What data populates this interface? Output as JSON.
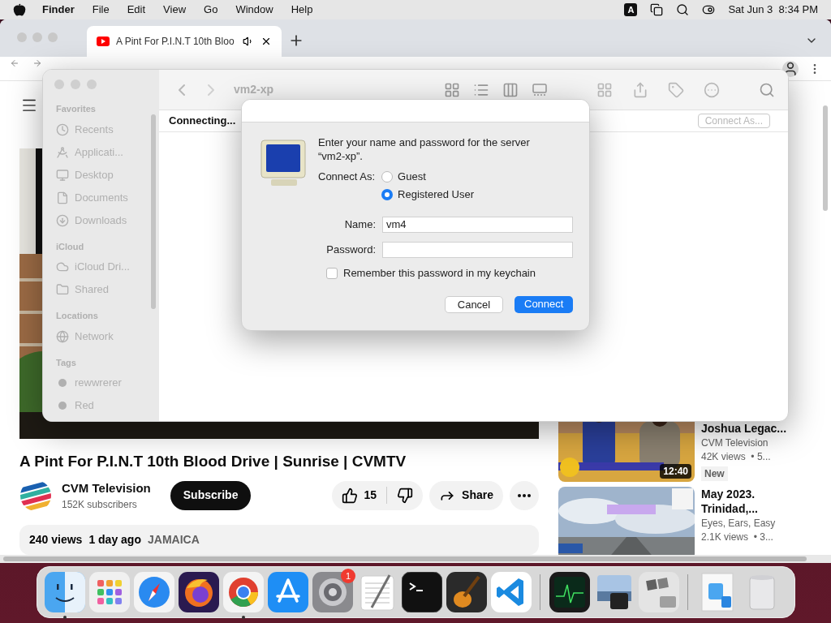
{
  "menu_bar": {
    "app": "Finder",
    "menus": [
      "File",
      "Edit",
      "View",
      "Go",
      "Window",
      "Help"
    ],
    "input_source": "A",
    "clock": "Sat Jun 3  8:34 PM"
  },
  "browser": {
    "tab": {
      "title": "A Pint For P.I.N.T 10th Bloo",
      "selected": true
    }
  },
  "video": {
    "title": "A Pint For P.I.N.T 10th Blood Drive | Sunrise | CVMTV",
    "channel": "CVM Television",
    "subscribers": "152K subscribers",
    "subscribe": "Subscribe",
    "likes": "15",
    "share": "Share",
    "views": "240 views",
    "age": "1 day ago",
    "tag": "JAMAICA"
  },
  "related": [
    {
      "title": "Joshua Legac...",
      "channel": "CVM Television",
      "meta": "42K views  • 5...",
      "badge": "New",
      "duration": "12:40"
    },
    {
      "title": "May 2023. Trinidad,...",
      "channel": "Eyes, Ears, Easy",
      "meta": "2.1K views  • 3..."
    }
  ],
  "finder": {
    "title": "vm2-xp",
    "status": "Connecting...",
    "connect_as": "Connect As...",
    "sidebar": [
      {
        "heading": "Favorites",
        "kind": "places",
        "items": [
          "Recents",
          "Applicati...",
          "Desktop",
          "Documents",
          "Downloads"
        ]
      },
      {
        "heading": "iCloud",
        "kind": "places",
        "items": [
          "iCloud Dri...",
          "Shared"
        ]
      },
      {
        "heading": "Locations",
        "kind": "places",
        "items": [
          "Network"
        ]
      },
      {
        "heading": "Tags",
        "kind": "tags",
        "items": [
          "rewwrerer",
          "Red"
        ]
      }
    ]
  },
  "dialog": {
    "message": "Enter your name and password for the server “vm2-xp”.",
    "connect_as_label": "Connect As:",
    "options": [
      {
        "label": "Guest",
        "selected": false
      },
      {
        "label": "Registered User",
        "selected": true
      }
    ],
    "name_label": "Name:",
    "name_value": "vm4",
    "password_label": "Password:",
    "remember": {
      "label": "Remember this password in my keychain",
      "checked": false
    },
    "buttons": [
      {
        "label": "Cancel",
        "kind": "normal"
      },
      {
        "label": "Connect",
        "kind": "default"
      }
    ]
  },
  "dock": {
    "items": [
      {
        "running": true
      },
      {
        "running": false
      },
      {
        "running": false
      },
      {
        "running": false
      },
      {
        "running": true
      },
      {
        "running": false
      },
      {
        "running": false,
        "badge": "1"
      },
      {
        "running": false
      },
      {
        "running": false
      },
      {
        "running": false
      },
      {
        "running": false
      },
      {
        "running": false
      },
      {
        "running": false
      },
      {
        "running": false
      },
      {
        "running": false
      },
      {
        "running": false
      }
    ]
  }
}
